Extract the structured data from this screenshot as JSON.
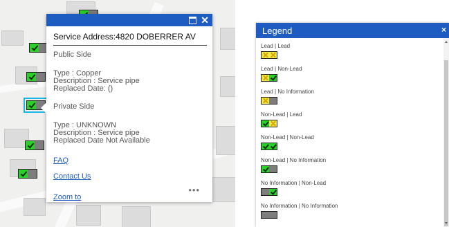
{
  "popup": {
    "title": "Service Address:4820 DOBERRER AV",
    "public_side": "Public Side",
    "public_type": "Type : Copper",
    "public_description": "Description : Service pipe",
    "public_replaced": "Replaced Date: ()",
    "private_side": "Private Side",
    "private_type": "Type : UNKNOWN",
    "private_description": "Description : Service pipe",
    "private_replaced": "Replaced Date Not Available",
    "faq": "FAQ",
    "contact": "Contact Us",
    "zoom": "Zoom to",
    "more": "•••"
  },
  "legend": {
    "title": "Legend",
    "close": "×",
    "items": [
      {
        "label": "Lead | Lead"
      },
      {
        "label": "Lead | Non-Lead"
      },
      {
        "label": "Lead | No Information"
      },
      {
        "label": "Non-Lead | Lead"
      },
      {
        "label": "Non-Lead | Non-Lead"
      },
      {
        "label": "Non-Lead | No Information"
      },
      {
        "label": "No Information | Non-Lead"
      },
      {
        "label": "No Information | No Information"
      }
    ]
  },
  "colors": {
    "accent": "#1f5cc2",
    "non_lead": "#2bd02b",
    "lead": "#f5e84a",
    "no_information": "#7d7d7d",
    "selection": "#19b6e6"
  }
}
